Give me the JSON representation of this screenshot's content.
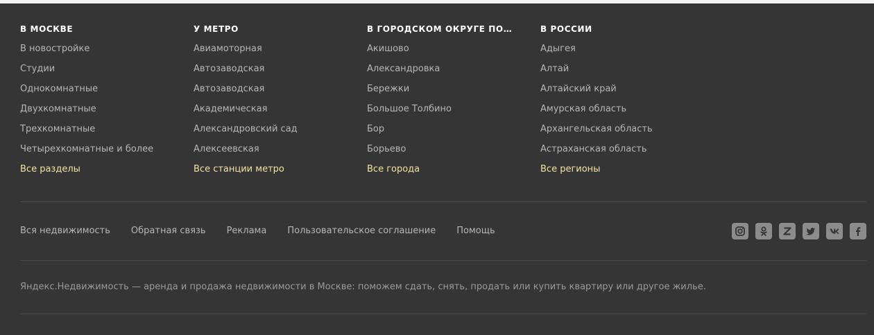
{
  "columns": [
    {
      "title": "В МОСКВЕ",
      "links": [
        "В новостройке",
        "Студии",
        "Однокомнатные",
        "Двухкомнатные",
        "Трехкомнатные",
        "Четырехкомнатные и более"
      ],
      "all_link": "Все разделы"
    },
    {
      "title": "У МЕТРО",
      "links": [
        "Авиамоторная",
        "Автозаводская",
        "Автозаводская",
        "Академическая",
        "Александровский сад",
        "Алексеевская"
      ],
      "all_link": "Все станции метро"
    },
    {
      "title": "В ГОРОДСКОМ ОКРУГЕ ПОДОЛ...",
      "links": [
        "Акишово",
        "Александровка",
        "Бережки",
        "Большое Толбино",
        "Бор",
        "Борьево"
      ],
      "all_link": "Все города"
    },
    {
      "title": "В РОССИИ",
      "links": [
        "Адыгея",
        "Алтай",
        "Алтайский край",
        "Амурская область",
        "Архангельская область",
        "Астраханская область"
      ],
      "all_link": "Все регионы"
    }
  ],
  "bottom_nav": [
    "Вся недвижимость",
    "Обратная связь",
    "Реклама",
    "Пользовательское соглашение",
    "Помощь"
  ],
  "socials": [
    "instagram-icon",
    "odnoklassniki-icon",
    "yandex-zen-icon",
    "twitter-icon",
    "vk-icon",
    "facebook-icon"
  ],
  "tagline": "Яндекс.Недвижимость — аренда и продажа недвижимости в Москве: поможем сдать, снять, продать или купить квартиру или другое жилье.",
  "colors": {
    "background": "#353535",
    "link": "#b6b6b4",
    "accent_link": "#f4e2a4",
    "heading": "#ffffff",
    "icon_bg": "#8c8c8c"
  }
}
